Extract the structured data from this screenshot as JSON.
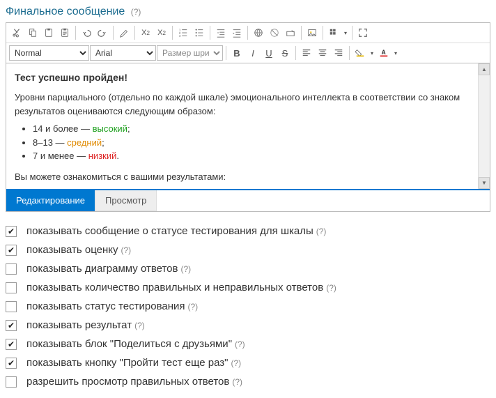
{
  "header": {
    "title": "Финальное сообщение",
    "help": "(?)"
  },
  "toolbar": {
    "format_select": "Normal",
    "font_select": "Arial",
    "size_placeholder": "Размер шриф",
    "btns": {
      "bold": "B",
      "italic": "I",
      "underline": "U",
      "strike": "S"
    }
  },
  "content": {
    "heading": "Тест успешно пройден!",
    "intro": "Уровни парциального (отдельно по каждой шкале) эмоционального интеллекта в соответствии со знаком результатов оцениваются следующим образом:",
    "levels": [
      {
        "range": "14 и более — ",
        "label": "высокий",
        "cls": "lv-high",
        "suffix": ";"
      },
      {
        "range": "8–13 — ",
        "label": "средний",
        "cls": "lv-mid",
        "suffix": ";"
      },
      {
        "range": "7 и менее — ",
        "label": "низкий",
        "cls": "lv-low",
        "suffix": "."
      }
    ],
    "outro": "Вы можете ознакомиться с вашими результатами:"
  },
  "tabs": {
    "edit": "Редактирование",
    "view": "Просмотр"
  },
  "options": [
    {
      "checked": true,
      "label": "показывать сообщение о статусе тестирования для шкалы"
    },
    {
      "checked": true,
      "label": "показывать оценку"
    },
    {
      "checked": false,
      "label": "показывать диаграмму ответов"
    },
    {
      "checked": false,
      "label": "показывать количество правильных и неправильных ответов"
    },
    {
      "checked": false,
      "label": "показывать статус тестирования"
    },
    {
      "checked": true,
      "label": "показывать результат"
    },
    {
      "checked": true,
      "label": "показывать блок \"Поделиться с друзьями\""
    },
    {
      "checked": true,
      "label": "показывать кнопку \"Пройти тест еще раз\""
    },
    {
      "checked": false,
      "label": "разрешить просмотр правильных ответов"
    }
  ],
  "help_marker": "(?)"
}
